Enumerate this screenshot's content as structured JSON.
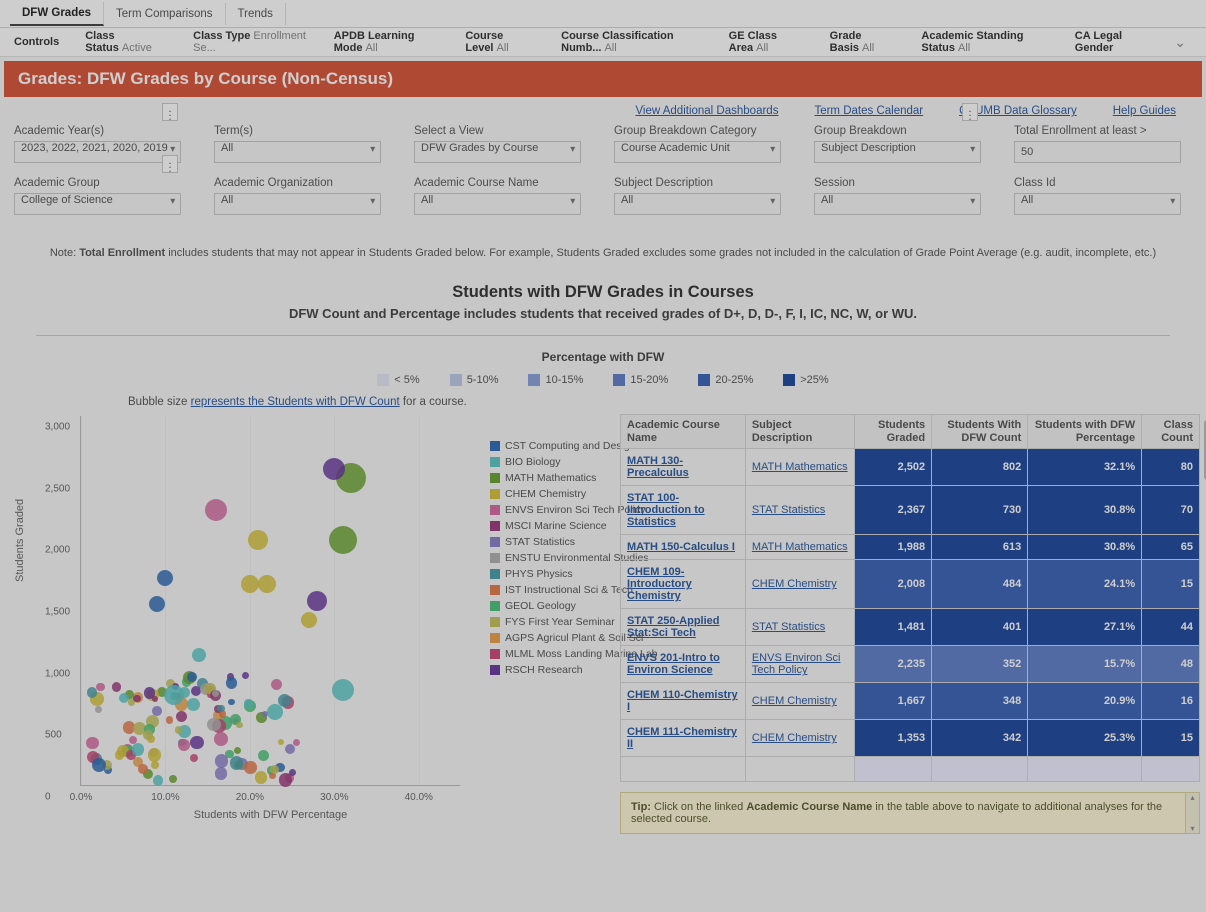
{
  "tabs": [
    "DFW Grades",
    "Term Comparisons",
    "Trends"
  ],
  "controls": {
    "label": "Controls",
    "items": [
      {
        "label": "Class Status",
        "value": "Active"
      },
      {
        "label": "Class Type",
        "value": "Enrollment Se..."
      },
      {
        "label": "APDB Learning Mode",
        "value": "All"
      },
      {
        "label": "Course Level",
        "value": "All"
      },
      {
        "label": "Course Classification Numb...",
        "value": "All"
      },
      {
        "label": "GE Class Area",
        "value": "All"
      },
      {
        "label": "Grade Basis",
        "value": "All"
      },
      {
        "label": "Academic Standing Status",
        "value": "All"
      },
      {
        "label": "CA Legal Gender",
        "value": ""
      }
    ]
  },
  "page_title": "Grades: DFW Grades by Course (Non-Census)",
  "links": [
    "View Additional Dashboards",
    "Term Dates Calendar",
    "CSUMB Data Glossary",
    "Help Guides"
  ],
  "filters_row1": [
    {
      "label": "Academic Year(s)",
      "value": "2023, 2022, 2021, 2020, 2019",
      "dots": true
    },
    {
      "label": "Term(s)",
      "value": "All"
    },
    {
      "label": "Select a View",
      "value": "DFW Grades by Course"
    },
    {
      "label": "Group Breakdown Category",
      "value": "Course Academic Unit"
    },
    {
      "label": "Group Breakdown",
      "value": "Subject Description",
      "dots": true
    },
    {
      "label": "Total Enrollment at least >",
      "value": "50",
      "input": true
    }
  ],
  "filters_row2": [
    {
      "label": "Academic Group",
      "value": "College of Science",
      "dots": true
    },
    {
      "label": "Academic Organization",
      "value": "All"
    },
    {
      "label": "Academic Course Name",
      "value": "All"
    },
    {
      "label": "Subject Description",
      "value": "All"
    },
    {
      "label": "Session",
      "value": "All"
    },
    {
      "label": "Class Id",
      "value": "All"
    }
  ],
  "note": {
    "prefix": "Note: ",
    "bold": "Total Enrollment",
    "rest": " includes students that may not appear in Students Graded below. For example, Students Graded excludes some grades not included in the calculation of Grade Point Average (e.g. audit, incomplete, etc.)"
  },
  "chart_header": {
    "title": "Students with DFW Grades in Courses",
    "subtitle": "DFW Count and Percentage includes students that received grades of D+, D, D-, F, I, IC, NC, W, or WU."
  },
  "pct_legend": {
    "title": "Percentage with DFW",
    "items": [
      {
        "label": "< 5%",
        "color": "#e3e7f5"
      },
      {
        "label": "5-10%",
        "color": "#bfc9e8"
      },
      {
        "label": "10-15%",
        "color": "#8aa0d8"
      },
      {
        "label": "15-20%",
        "color": "#5f7fc8"
      },
      {
        "label": "20-25%",
        "color": "#3a63b8"
      },
      {
        "label": ">25%",
        "color": "#1e4a9e"
      }
    ]
  },
  "scatter": {
    "caption_prefix": "Bubble size ",
    "caption_link": "represents the Students with DFW Count",
    "caption_suffix": " for a course.",
    "ylabel": "Students Graded",
    "xlabel": "Students with DFW Percentage",
    "xticks": [
      "0.0%",
      "10.0%",
      "20.0%",
      "30.0%",
      "40.0%"
    ],
    "yticks": [
      "0",
      "500",
      "1,000",
      "1,500",
      "2,000",
      "2,500",
      "3,000"
    ]
  },
  "scatter_legend": [
    {
      "label": "CST Computing and Design",
      "color": "#2e6cb5"
    },
    {
      "label": "BIO Biology",
      "color": "#5cc6c6"
    },
    {
      "label": "MATH Mathematics",
      "color": "#6aa331"
    },
    {
      "label": "CHEM Chemistry",
      "color": "#d6c13a"
    },
    {
      "label": "ENVS Environ Sci Tech Policy",
      "color": "#d46aa0"
    },
    {
      "label": "MSCI Marine Science",
      "color": "#9e3a7e"
    },
    {
      "label": "STAT Statistics",
      "color": "#8a7fc8"
    },
    {
      "label": "ENSTU Environmental Studies",
      "color": "#b0b0b0"
    },
    {
      "label": "PHYS Physics",
      "color": "#4a9eaa"
    },
    {
      "label": "IST Instructional Sci & Tech",
      "color": "#e07a4a"
    },
    {
      "label": "GEOL Geology",
      "color": "#4ac27a"
    },
    {
      "label": "FYS First Year Seminar",
      "color": "#c2c25a"
    },
    {
      "label": "AGPS Agricul Plant & Soil Sci",
      "color": "#e8a04a"
    },
    {
      "label": "MLML Moss Landing Marine Lab",
      "color": "#c94a7a"
    },
    {
      "label": "RSCH Research",
      "color": "#6a3a9e"
    }
  ],
  "table": {
    "headers": [
      "Academic Course Name",
      "Subject Description",
      "Students Graded",
      "Students With DFW Count",
      "Students with DFW Percentage",
      "Class Count"
    ],
    "rows": [
      {
        "name": "MATH 130-Precalculus",
        "subj": "MATH Mathematics",
        "graded": "2,502",
        "dfw": "802",
        "pct": "32.1%",
        "cc": "80",
        "color": "#1e4a9e"
      },
      {
        "name": "STAT 100-Introduction to Statistics",
        "subj": "STAT Statistics",
        "graded": "2,367",
        "dfw": "730",
        "pct": "30.8%",
        "cc": "70",
        "color": "#1e4a9e"
      },
      {
        "name": "MATH 150-Calculus I",
        "subj": "MATH Mathematics",
        "graded": "1,988",
        "dfw": "613",
        "pct": "30.8%",
        "cc": "65",
        "color": "#1e4a9e"
      },
      {
        "name": "CHEM 109-Introductory Chemistry",
        "subj": "CHEM Chemistry",
        "graded": "2,008",
        "dfw": "484",
        "pct": "24.1%",
        "cc": "15",
        "color": "#3a63b8"
      },
      {
        "name": "STAT 250-Applied Stat:Sci Tech",
        "subj": "STAT Statistics",
        "graded": "1,481",
        "dfw": "401",
        "pct": "27.1%",
        "cc": "44",
        "color": "#1e4a9e"
      },
      {
        "name": "ENVS 201-Intro to Environ Science",
        "subj": "ENVS Environ Sci Tech Policy",
        "graded": "2,235",
        "dfw": "352",
        "pct": "15.7%",
        "cc": "48",
        "color": "#5f7fc8"
      },
      {
        "name": "CHEM 110-Chemistry I",
        "subj": "CHEM Chemistry",
        "graded": "1,667",
        "dfw": "348",
        "pct": "20.9%",
        "cc": "16",
        "color": "#3a63b8"
      },
      {
        "name": "CHEM 111-Chemistry II",
        "subj": "CHEM Chemistry",
        "graded": "1,353",
        "dfw": "342",
        "pct": "25.3%",
        "cc": "15",
        "color": "#1e4a9e"
      }
    ]
  },
  "tip": {
    "bold1": "Tip: ",
    "text1": "Click on the linked ",
    "bold2": "Academic Course Name",
    "text2": " in the table above to navigate to additional analyses for the selected course."
  },
  "chart_data": {
    "type": "scatter",
    "title": "Students with DFW Grades in Courses",
    "xlabel": "Students with DFW Percentage",
    "ylabel": "Students Graded",
    "xlim": [
      0,
      45
    ],
    "ylim": [
      0,
      3000
    ],
    "size_encoding": "Students with DFW Count",
    "series_note": "bubbles colored by Subject Description; sample of visible points estimated from plot",
    "points_sample": [
      {
        "subj": "MATH Mathematics",
        "x": 32,
        "y": 2500,
        "size": 800
      },
      {
        "subj": "MATH Mathematics",
        "x": 31,
        "y": 2000,
        "size": 613
      },
      {
        "subj": "STAT Statistics",
        "x": 31,
        "y": 2367,
        "size": 730,
        "note": "approx"
      },
      {
        "subj": "ENVS Environ Sci Tech Policy",
        "x": 16,
        "y": 2235,
        "size": 352
      },
      {
        "subj": "CHEM Chemistry",
        "x": 24,
        "y": 2008,
        "size": 484
      },
      {
        "subj": "CHEM Chemistry",
        "x": 21,
        "y": 1667,
        "size": 348
      },
      {
        "subj": "RSCH Research",
        "x": 28,
        "y": 1500,
        "size": 300
      },
      {
        "subj": "CST Computing and Design",
        "x": 9,
        "y": 1480,
        "size": 150
      },
      {
        "subj": "BIO Biology",
        "x": 10,
        "y": 740,
        "size": 80
      }
    ]
  }
}
